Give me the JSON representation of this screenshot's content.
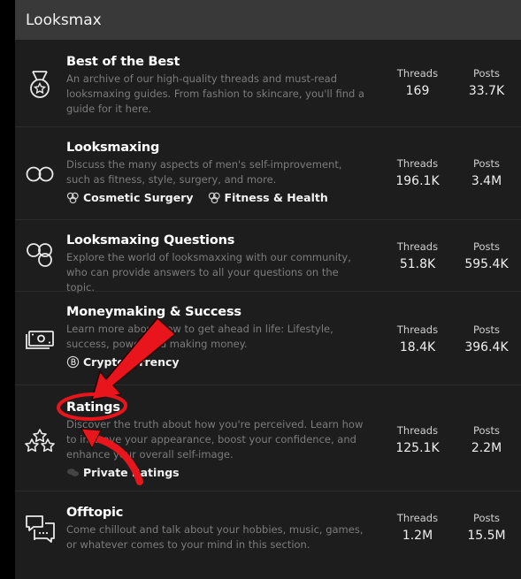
{
  "section": {
    "title": "Looksmax"
  },
  "labels": {
    "threads": "Threads",
    "posts": "Posts"
  },
  "nodes": [
    {
      "title": "Best of the Best",
      "desc": "An archive of our high-quality threads and must-read looksmaxing guides. From fashion to skincare, you'll find a guide for it here.",
      "threads": "169",
      "posts": "33.7K",
      "icon": "medal-icon",
      "subforums": []
    },
    {
      "title": "Looksmaxing",
      "desc": "Discuss the many aspects of men's self-improvement, such as fitness, style, surgery, and more.",
      "threads": "196.1K",
      "posts": "3.4M",
      "icon": "infinity-icon",
      "subforums": [
        "Cosmetic Surgery",
        "Fitness & Health"
      ]
    },
    {
      "title": "Looksmaxing Questions",
      "desc": "Explore the world of looksmaxxing with our community, who can provide answers to all your questions on the topic.",
      "threads": "51.8K",
      "posts": "595.4K",
      "icon": "circles-icon",
      "subforums": []
    },
    {
      "title": "Moneymaking & Success",
      "desc": "Learn more about how to get ahead in life: Lifestyle, success, power and making money.",
      "threads": "18.4K",
      "posts": "396.4K",
      "icon": "money-icon",
      "subforums": [
        "Cryptocurrency"
      ]
    },
    {
      "title": "Ratings",
      "desc": "Discover the truth about how you're perceived. Learn how to improve your appearance, boost your confidence, and enhance your overall self-image.",
      "threads": "125.1K",
      "posts": "2.2M",
      "icon": "stars-icon",
      "subforums": [
        "Private Ratings"
      ]
    },
    {
      "title": "Offtopic",
      "desc": "Come chillout and talk about your hobbies, music, games, or whatever comes to your mind in this section.",
      "threads": "1.2M",
      "posts": "15.5M",
      "icon": "chat-icon",
      "subforums": []
    }
  ],
  "colors": {
    "annotation": "#e8161c",
    "panel": "#1d1d1d",
    "header": "#393939"
  }
}
